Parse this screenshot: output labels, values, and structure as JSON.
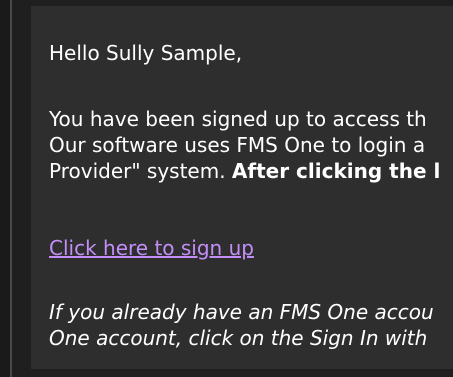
{
  "email": {
    "greeting": "Hello Sully Sample,",
    "intro_line1": "You have been signed up to access th",
    "intro_line2": "Our software uses FMS One to login a",
    "intro_line3_text": "Provider\" system. ",
    "intro_line3_bold": "After clicking the l",
    "signup_link": "Click here to sign up",
    "note_line1": "If you already have an FMS One accou",
    "note_line2": "One account, click on the Sign In with"
  },
  "colors": {
    "background": "#1f1f1f",
    "panel": "#2e2e2e",
    "text": "#ffffff",
    "link": "#c38ef8"
  }
}
